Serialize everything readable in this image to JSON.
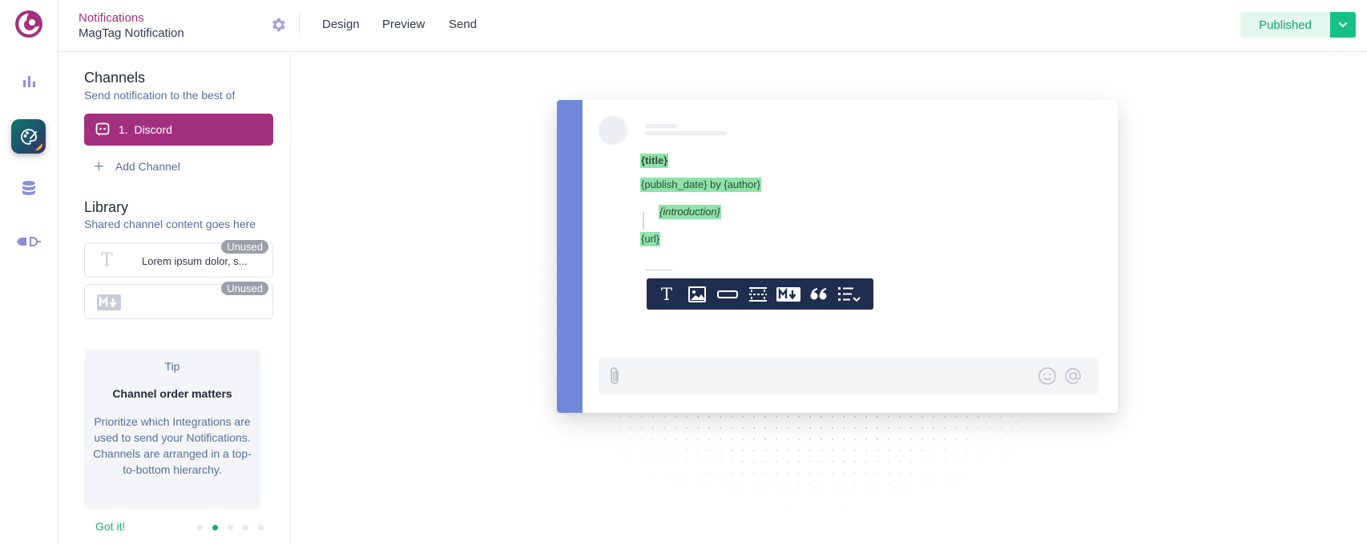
{
  "header": {
    "breadcrumb_parent": "Notifications",
    "notification_name": "MagTag Notification",
    "tabs": [
      "Design",
      "Preview",
      "Send"
    ],
    "status_button": "Published"
  },
  "rail": {
    "icons": [
      "logo-icon",
      "analytics-icon",
      "designer-icon",
      "data-icon",
      "integrations-icon"
    ]
  },
  "channels": {
    "title": "Channels",
    "subtitle": "Send notification to the best of",
    "items": [
      {
        "label": "1.  Discord",
        "icon": "discord-icon"
      }
    ],
    "add_label": "Add Channel"
  },
  "library": {
    "title": "Library",
    "subtitle": "Shared channel content goes here",
    "items": [
      {
        "type": "text",
        "preview": "Lorem ipsum dolor, s...",
        "badge": "Unused"
      },
      {
        "type": "markdown",
        "preview": "",
        "badge": "Unused"
      }
    ]
  },
  "tip": {
    "heading": "Tip",
    "title": "Channel order matters",
    "body": "Prioritize which Integrations are used to send your Notifications. Channels are arranged in a top-to-bottom hierarchy.",
    "action": "Got it!",
    "pages": 5,
    "current_page": 2
  },
  "preview": {
    "title_var": "{title}",
    "meta_var": "{publish_date} by {author}",
    "intro_var": "{introduction}",
    "url_var": "{url}",
    "toolbar_tools": [
      "text-block-icon",
      "image-block-icon",
      "button-block-icon",
      "divider-block-icon",
      "markdown-block-icon",
      "quote-block-icon",
      "list-block-icon"
    ]
  },
  "colors": {
    "brand": "#a3307f",
    "success": "#15c184",
    "discord_accent": "#7289da",
    "toolbar": "#1f2d4e",
    "variable_highlight": "#8fe3a9"
  }
}
